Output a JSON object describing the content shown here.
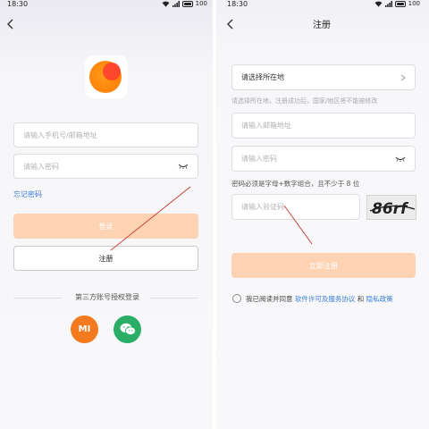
{
  "status_bar": {
    "time": "18:30",
    "battery": "100"
  },
  "login_screen": {
    "phone_email_placeholder": "请输入手机号/邮箱地址",
    "password_placeholder": "请输入密码",
    "forgot_password": "忘记密码",
    "login_button": "登录",
    "register_button": "注册",
    "third_party_label": "第三方账号授权登录",
    "mi_label": "MI"
  },
  "register_screen": {
    "title": "注册",
    "region_select": "请选择所在地",
    "region_hint": "请选择所在地，注册成功后，国家/地区将不能被修改",
    "email_placeholder": "请输入邮箱地址",
    "password_placeholder": "请输入密码",
    "password_rule": "密码必须是字母+数字组合，且不少于 8 位",
    "captcha_placeholder": "请输入验证码",
    "captcha_text": "86rf",
    "submit_button": "立即注册",
    "agree_prefix": "我已阅读并同意",
    "agree_link_terms": "软件许可及服务协议",
    "agree_and": "和",
    "agree_link_privacy": "隐私政策"
  },
  "colors": {
    "primary_disabled": "#fdd3b4",
    "link": "#3a7bd5",
    "mi_orange": "#f47a1f",
    "wechat_green": "#2aae67",
    "annotation_red": "#c0392b"
  }
}
